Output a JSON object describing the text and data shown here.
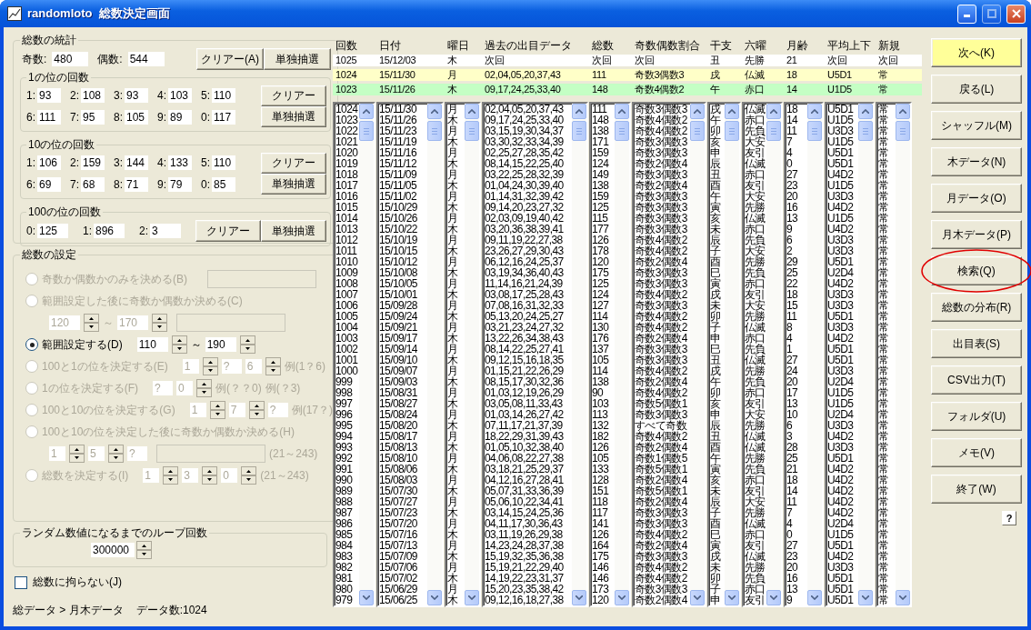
{
  "window": {
    "title": "randomloto  総数決定画面"
  },
  "stats": {
    "title": "総数の統計",
    "odd_label": "奇数:",
    "odd": "480",
    "even_label": "偶数:",
    "even": "544",
    "buttons": [
      "クリアー(A)",
      "単独抽選"
    ],
    "groups": [
      {
        "title": "1の位の回数",
        "counts": [
          {
            "label": "1:",
            "value": "93"
          },
          {
            "label": "2:",
            "value": "108"
          },
          {
            "label": "3:",
            "value": "93"
          },
          {
            "label": "4:",
            "value": "103"
          },
          {
            "label": "5:",
            "value": "110"
          },
          {
            "label": "6:",
            "value": "111"
          },
          {
            "label": "7:",
            "value": "95"
          },
          {
            "label": "8:",
            "value": "105"
          },
          {
            "label": "9:",
            "value": "89"
          },
          {
            "label": "0:",
            "value": "117"
          }
        ],
        "buttons": [
          "クリアー",
          "単独抽選"
        ]
      },
      {
        "title": "10の位の回数",
        "counts": [
          {
            "label": "1:",
            "value": "106"
          },
          {
            "label": "2:",
            "value": "159"
          },
          {
            "label": "3:",
            "value": "144"
          },
          {
            "label": "4:",
            "value": "133"
          },
          {
            "label": "5:",
            "value": "110"
          },
          {
            "label": "6:",
            "value": "69"
          },
          {
            "label": "7:",
            "value": "68"
          },
          {
            "label": "8:",
            "value": "71"
          },
          {
            "label": "9:",
            "value": "79"
          },
          {
            "label": "0:",
            "value": "85"
          }
        ],
        "buttons": [
          "クリアー",
          "単独抽選"
        ]
      },
      {
        "title": "100の位の回数",
        "counts": [
          {
            "label": "0:",
            "value": "125"
          },
          {
            "label": "1:",
            "value": "896"
          },
          {
            "label": "2:",
            "value": "3"
          }
        ],
        "buttons": [
          "クリアー",
          "単独抽選"
        ]
      }
    ]
  },
  "settings": {
    "title": "総数の設定",
    "options": [
      {
        "label": "奇数か偶数かのみを決める(B)",
        "selected": false,
        "disabled": true,
        "controls": [
          {
            "kind": "blank"
          }
        ]
      },
      {
        "label": "範囲設定した後に奇数か偶数か決める(C)",
        "selected": false,
        "disabled": true,
        "below": [
          {
            "kind": "spin",
            "value": "120"
          },
          {
            "kind": "text",
            "value": "～"
          },
          {
            "kind": "spin",
            "value": "170"
          },
          {
            "kind": "blank"
          }
        ]
      },
      {
        "label": "範囲設定する(D)",
        "selected": true,
        "disabled": false,
        "controls": [
          {
            "kind": "spin",
            "value": "110"
          },
          {
            "kind": "text",
            "value": "～"
          },
          {
            "kind": "spin",
            "value": "190"
          }
        ]
      },
      {
        "label": "100と1の位を決定する(E)",
        "selected": false,
        "disabled": true,
        "controls": [
          {
            "kind": "spin",
            "value": "1"
          },
          {
            "kind": "box",
            "value": "?"
          },
          {
            "kind": "spin",
            "value": "6"
          },
          {
            "kind": "text",
            "value": "例(1？6)"
          }
        ]
      },
      {
        "label": "1の位を決定する(F)",
        "selected": false,
        "disabled": true,
        "controls": [
          {
            "kind": "box",
            "value": "?"
          },
          {
            "kind": "spin",
            "value": "0"
          },
          {
            "kind": "text",
            "value": "例(？？0)"
          },
          {
            "kind": "text",
            "value": "例(？3)"
          }
        ]
      },
      {
        "label": "100と10の位を決定する(G)",
        "selected": false,
        "disabled": true,
        "controls": [
          {
            "kind": "spin",
            "value": "1"
          },
          {
            "kind": "spin",
            "value": "7"
          },
          {
            "kind": "box",
            "value": "?"
          },
          {
            "kind": "text",
            "value": "例(17？)"
          }
        ]
      },
      {
        "label": "100と10の位を決定した後に奇数か偶数か決める(H)",
        "selected": false,
        "disabled": true,
        "below": [
          {
            "kind": "spin",
            "value": "1"
          },
          {
            "kind": "spin",
            "value": "5"
          },
          {
            "kind": "box",
            "value": "?"
          },
          {
            "kind": "blank"
          },
          {
            "kind": "text",
            "value": "(21～243)"
          }
        ]
      },
      {
        "label": "総数を決定する(I)",
        "selected": false,
        "disabled": true,
        "controls": [
          {
            "kind": "spin",
            "value": "1"
          },
          {
            "kind": "spin",
            "value": "3"
          },
          {
            "kind": "spin",
            "value": "0"
          },
          {
            "kind": "text",
            "value": "(21～243)"
          }
        ]
      }
    ]
  },
  "loop": {
    "title": "ランダム数値になるまでのループ回数",
    "value": "300000"
  },
  "checkbox": {
    "label": "総数に拘らない(J)",
    "checked": false
  },
  "status": {
    "path": "総データ > 月木データ",
    "count": "データ数:1024"
  },
  "table": {
    "columns": [
      "回数",
      "日付",
      "曜日",
      "過去の出目データ",
      "総数",
      "奇数偶数割合",
      "干支",
      "六曜",
      "月齢",
      "平均上下",
      "新規"
    ],
    "summary_rows": [
      {
        "color": "#ffffff",
        "cells": [
          "1025",
          "15/12/03",
          "木",
          "次回",
          "次回",
          "次回",
          "丑",
          "先勝",
          "21",
          "次回",
          "次回"
        ]
      },
      {
        "color": "#ffffc8",
        "cells": [
          "1024",
          "15/11/30",
          "月",
          "02,04,05,20,37,43",
          "111",
          "奇数3偶数3",
          "戌",
          "仏滅",
          "18",
          "U5D1",
          "常"
        ]
      },
      {
        "color": "#c4ffc4",
        "cells": [
          "1023",
          "15/11/26",
          "木",
          "09,17,24,25,33,40",
          "148",
          "奇数4偶数2",
          "午",
          "赤口",
          "14",
          "U1D5",
          "常"
        ]
      }
    ],
    "rows": [
      [
        "1024",
        "15/11/30",
        "月",
        "02,04,05,20,37,43",
        "111",
        "奇数3偶数3",
        "戌",
        "仏滅",
        "18",
        "U5D1",
        "常"
      ],
      [
        "1023",
        "15/11/26",
        "木",
        "09,17,24,25,33,40",
        "148",
        "奇数4偶数2",
        "午",
        "赤口",
        "14",
        "U1D5",
        "常"
      ],
      [
        "1022",
        "15/11/23",
        "月",
        "03,15,19,30,34,37",
        "138",
        "奇数4偶数2",
        "卯",
        "先負",
        "11",
        "U3D3",
        "常"
      ],
      [
        "1021",
        "15/11/19",
        "木",
        "03,30,32,33,34,39",
        "171",
        "奇数3偶数3",
        "亥",
        "大安",
        "7",
        "U1D5",
        "常"
      ],
      [
        "1020",
        "15/11/16",
        "月",
        "02,25,27,28,35,42",
        "159",
        "奇数3偶数3",
        "申",
        "友引",
        "4",
        "U5D1",
        "常"
      ],
      [
        "1019",
        "15/11/12",
        "木",
        "08,14,15,22,25,40",
        "124",
        "奇数2偶数4",
        "辰",
        "仏滅",
        "0",
        "U5D1",
        "常"
      ],
      [
        "1018",
        "15/11/09",
        "月",
        "03,22,25,28,32,39",
        "149",
        "奇数3偶数3",
        "丑",
        "赤口",
        "27",
        "U4D2",
        "常"
      ],
      [
        "1017",
        "15/11/05",
        "木",
        "01,04,24,30,39,40",
        "138",
        "奇数2偶数4",
        "酉",
        "友引",
        "23",
        "U1D5",
        "常"
      ],
      [
        "1016",
        "15/11/02",
        "月",
        "01,14,31,32,39,42",
        "159",
        "奇数3偶数3",
        "午",
        "大安",
        "20",
        "U3D3",
        "常"
      ],
      [
        "1015",
        "15/10/29",
        "木",
        "09,14,20,23,27,32",
        "125",
        "奇数3偶数3",
        "寅",
        "先勝",
        "16",
        "U4D2",
        "常"
      ],
      [
        "1014",
        "15/10/26",
        "月",
        "02,03,09,19,40,42",
        "115",
        "奇数3偶数3",
        "亥",
        "仏滅",
        "13",
        "U1D5",
        "常"
      ],
      [
        "1013",
        "15/10/22",
        "木",
        "03,20,36,38,39,41",
        "177",
        "奇数3偶数3",
        "未",
        "赤口",
        "9",
        "U4D2",
        "常"
      ],
      [
        "1012",
        "15/10/19",
        "月",
        "09,11,19,22,27,38",
        "126",
        "奇数4偶数2",
        "辰",
        "先負",
        "6",
        "U3D3",
        "常"
      ],
      [
        "1011",
        "15/10/15",
        "木",
        "23,26,27,29,30,43",
        "178",
        "奇数4偶数2",
        "子",
        "大安",
        "2",
        "U3D3",
        "常"
      ],
      [
        "1010",
        "15/10/12",
        "月",
        "06,12,16,24,25,37",
        "120",
        "奇数2偶数4",
        "酉",
        "先勝",
        "29",
        "U5D1",
        "常"
      ],
      [
        "1009",
        "15/10/08",
        "木",
        "03,19,34,36,40,43",
        "175",
        "奇数3偶数3",
        "巳",
        "先負",
        "25",
        "U2D4",
        "常"
      ],
      [
        "1008",
        "15/10/05",
        "月",
        "11,14,16,21,24,39",
        "125",
        "奇数3偶数3",
        "寅",
        "赤口",
        "22",
        "U4D2",
        "常"
      ],
      [
        "1007",
        "15/10/01",
        "木",
        "03,08,17,25,28,43",
        "124",
        "奇数4偶数2",
        "戌",
        "友引",
        "18",
        "U3D3",
        "常"
      ],
      [
        "1006",
        "15/09/28",
        "月",
        "07,08,16,31,32,33",
        "127",
        "奇数3偶数3",
        "未",
        "大安",
        "15",
        "U3D3",
        "常"
      ],
      [
        "1005",
        "15/09/24",
        "木",
        "05,13,20,24,25,27",
        "114",
        "奇数4偶数2",
        "卯",
        "先勝",
        "11",
        "U5D1",
        "常"
      ],
      [
        "1004",
        "15/09/21",
        "月",
        "03,21,23,24,27,32",
        "130",
        "奇数4偶数2",
        "子",
        "仏滅",
        "8",
        "U3D3",
        "常"
      ],
      [
        "1003",
        "15/09/17",
        "木",
        "13,22,26,34,38,43",
        "176",
        "奇数2偶数4",
        "申",
        "赤口",
        "4",
        "U4D2",
        "常"
      ],
      [
        "1002",
        "15/09/14",
        "月",
        "08,14,22,25,27,41",
        "137",
        "奇数3偶数3",
        "巳",
        "先負",
        "1",
        "U5D1",
        "常"
      ],
      [
        "1001",
        "15/09/10",
        "木",
        "09,12,15,16,18,35",
        "105",
        "奇数3偶数3",
        "丑",
        "仏滅",
        "27",
        "U5D1",
        "常"
      ],
      [
        "1000",
        "15/09/07",
        "月",
        "01,15,21,22,26,29",
        "114",
        "奇数4偶数2",
        "戌",
        "先勝",
        "24",
        "U3D3",
        "常"
      ],
      [
        "999",
        "15/09/03",
        "木",
        "08,15,17,30,32,36",
        "138",
        "奇数2偶数4",
        "午",
        "先負",
        "20",
        "U2D4",
        "常"
      ],
      [
        "998",
        "15/08/31",
        "月",
        "01,03,12,19,26,29",
        "90",
        "奇数4偶数2",
        "卯",
        "赤口",
        "17",
        "U1D5",
        "常"
      ],
      [
        "997",
        "15/08/27",
        "木",
        "03,05,08,11,33,43",
        "103",
        "奇数5偶数1",
        "亥",
        "友引",
        "13",
        "U1D5",
        "常"
      ],
      [
        "996",
        "15/08/24",
        "月",
        "01,03,14,26,27,42",
        "113",
        "奇数3偶数3",
        "申",
        "大安",
        "10",
        "U2D4",
        "常"
      ],
      [
        "995",
        "15/08/20",
        "木",
        "07,11,17,21,37,39",
        "132",
        "すべて奇数",
        "辰",
        "先勝",
        "6",
        "U3D3",
        "常"
      ],
      [
        "994",
        "15/08/17",
        "月",
        "18,22,29,31,39,43",
        "182",
        "奇数4偶数2",
        "丑",
        "仏滅",
        "3",
        "U4D2",
        "常"
      ],
      [
        "993",
        "15/08/13",
        "木",
        "01,05,10,32,38,40",
        "126",
        "奇数2偶数4",
        "酉",
        "仏滅",
        "28",
        "U3D3",
        "常"
      ],
      [
        "992",
        "15/08/10",
        "月",
        "04,06,08,22,27,38",
        "105",
        "奇数1偶数5",
        "午",
        "先勝",
        "25",
        "U5D1",
        "常"
      ],
      [
        "991",
        "15/08/06",
        "木",
        "03,18,21,25,29,37",
        "133",
        "奇数5偶数1",
        "寅",
        "先負",
        "21",
        "U4D2",
        "常"
      ],
      [
        "990",
        "15/08/03",
        "月",
        "04,12,16,27,28,41",
        "128",
        "奇数2偶数4",
        "亥",
        "赤口",
        "18",
        "U4D2",
        "常"
      ],
      [
        "989",
        "15/07/30",
        "木",
        "05,07,31,33,36,39",
        "151",
        "奇数5偶数1",
        "未",
        "友引",
        "14",
        "U4D2",
        "常"
      ],
      [
        "988",
        "15/07/27",
        "月",
        "05,06,10,22,34,41",
        "118",
        "奇数2偶数4",
        "辰",
        "大安",
        "11",
        "U4D2",
        "常"
      ],
      [
        "987",
        "15/07/23",
        "木",
        "03,14,15,24,25,36",
        "117",
        "奇数3偶数3",
        "子",
        "先勝",
        "7",
        "U4D2",
        "常"
      ],
      [
        "986",
        "15/07/20",
        "月",
        "04,11,17,30,36,43",
        "141",
        "奇数3偶数3",
        "酉",
        "仏滅",
        "4",
        "U2D4",
        "常"
      ],
      [
        "985",
        "15/07/16",
        "木",
        "03,11,19,26,29,38",
        "126",
        "奇数4偶数2",
        "巳",
        "赤口",
        "0",
        "U1D5",
        "常"
      ],
      [
        "984",
        "15/07/13",
        "月",
        "14,23,24,28,37,38",
        "164",
        "奇数2偶数4",
        "寅",
        "友引",
        "27",
        "U5D1",
        "常"
      ],
      [
        "983",
        "15/07/09",
        "木",
        "15,19,32,35,36,38",
        "175",
        "奇数3偶数3",
        "戌",
        "仏滅",
        "23",
        "U4D2",
        "常"
      ],
      [
        "982",
        "15/07/06",
        "月",
        "15,19,21,22,29,40",
        "146",
        "奇数4偶数2",
        "未",
        "先勝",
        "20",
        "U3D3",
        "常"
      ],
      [
        "981",
        "15/07/02",
        "木",
        "14,19,22,23,31,37",
        "146",
        "奇数4偶数2",
        "卯",
        "先負",
        "16",
        "U5D1",
        "常"
      ],
      [
        "980",
        "15/06/29",
        "月",
        "15,20,23,35,38,42",
        "173",
        "奇数3偶数3",
        "子",
        "赤口",
        "13",
        "U5D1",
        "常"
      ],
      [
        "979",
        "15/06/25",
        "木",
        "09,12,16,18,27,38",
        "120",
        "奇数2偶数4",
        "申",
        "友引",
        "9",
        "U5D1",
        "常"
      ]
    ]
  },
  "nav_buttons": [
    {
      "label": "次へ(K)",
      "highlighted": true,
      "circled": false
    },
    {
      "label": "戻る(L)",
      "highlighted": false,
      "circled": false
    },
    {
      "label": "シャッフル(M)",
      "highlighted": false,
      "circled": false
    },
    {
      "label": "木データ(N)",
      "highlighted": false,
      "circled": false
    },
    {
      "label": "月データ(O)",
      "highlighted": false,
      "circled": false
    },
    {
      "label": "月木データ(P)",
      "highlighted": false,
      "circled": false
    },
    {
      "label": "検索(Q)",
      "highlighted": false,
      "circled": true
    },
    {
      "label": "総数の分布(R)",
      "highlighted": false,
      "circled": false
    },
    {
      "label": "出目表(S)",
      "highlighted": false,
      "circled": false
    },
    {
      "label": "CSV出力(T)",
      "highlighted": false,
      "circled": false
    },
    {
      "label": "フォルダ(U)",
      "highlighted": false,
      "circled": false
    },
    {
      "label": "メモ(V)",
      "highlighted": false,
      "circled": false
    },
    {
      "label": "終了(W)",
      "highlighted": false,
      "circled": false
    }
  ],
  "help_button": "?"
}
